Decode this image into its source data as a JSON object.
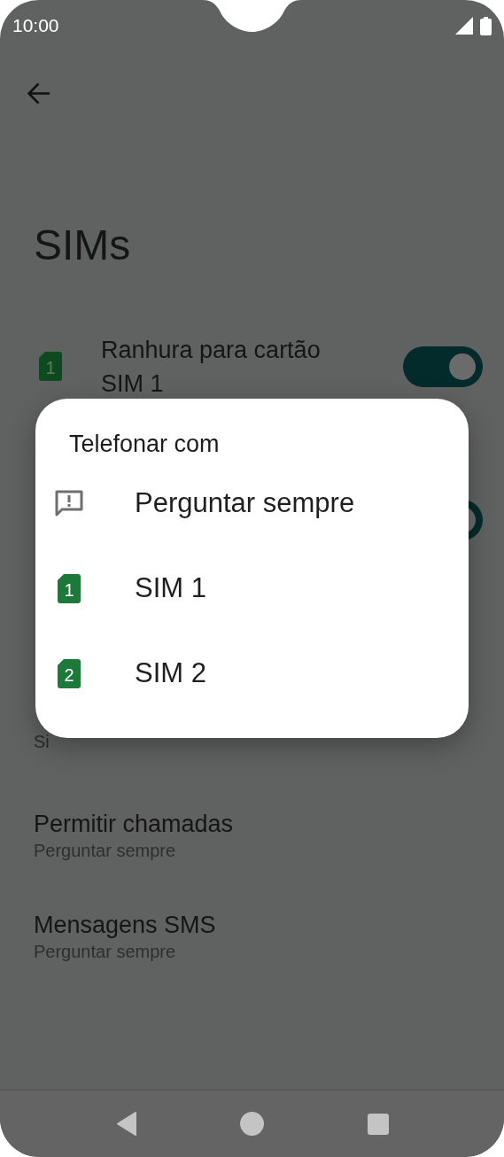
{
  "status_bar": {
    "time": "10:00"
  },
  "title": "SIMs",
  "sim_slots": [
    {
      "label": "Ranhura para cartão SIM 1",
      "sim_number": "1",
      "on": true
    },
    {
      "on": true
    }
  ],
  "partial_row": {
    "label": "Si"
  },
  "settings": [
    {
      "title": "Permitir chamadas",
      "value": "Perguntar sempre"
    },
    {
      "title": "Mensagens SMS",
      "value": "Perguntar sempre"
    }
  ],
  "dialog": {
    "title": "Telefonar com",
    "options": [
      {
        "kind": "ask",
        "label": "Perguntar sempre"
      },
      {
        "kind": "sim",
        "sim_number": "1",
        "label": "SIM 1"
      },
      {
        "kind": "sim",
        "sim_number": "2",
        "label": "SIM 2"
      }
    ]
  }
}
